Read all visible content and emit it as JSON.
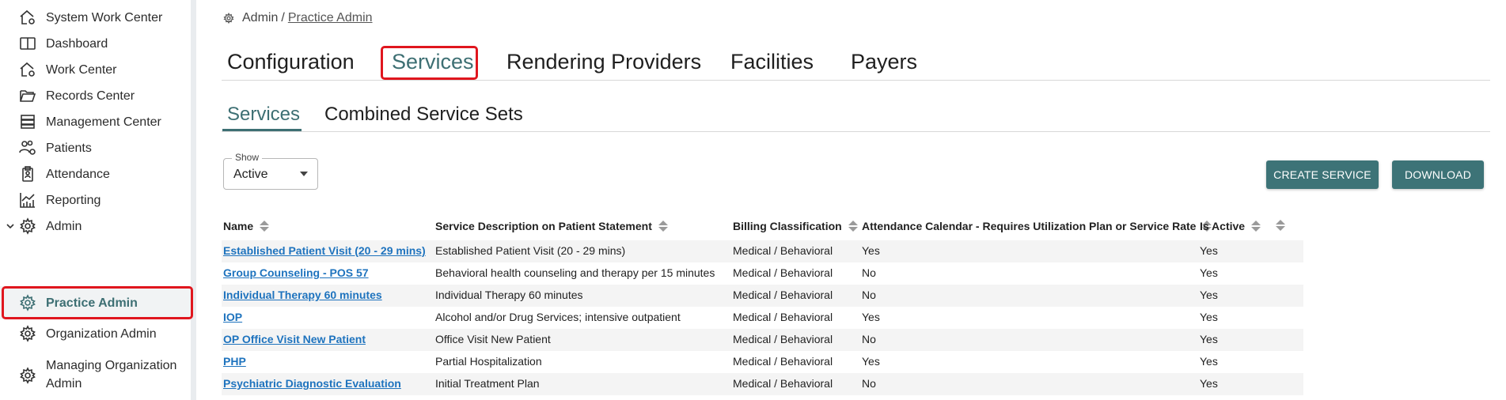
{
  "sidebar": {
    "items": [
      {
        "label": "System Work Center",
        "icon": "home-gear-icon"
      },
      {
        "label": "Dashboard",
        "icon": "book-icon"
      },
      {
        "label": "Work Center",
        "icon": "home-gear-icon"
      },
      {
        "label": "Records Center",
        "icon": "folder-open-icon"
      },
      {
        "label": "Management Center",
        "icon": "server-icon"
      },
      {
        "label": "Patients",
        "icon": "users-gear-icon"
      },
      {
        "label": "Attendance",
        "icon": "clipboard-icon"
      },
      {
        "label": "Reporting",
        "icon": "chart-icon"
      },
      {
        "label": "Admin",
        "icon": "gear-icon"
      },
      {
        "label": "Practice Admin",
        "icon": "gear-icon"
      },
      {
        "label": "Organization Admin",
        "icon": "gear-icon"
      },
      {
        "label": "Managing Organization",
        "label2": "Admin",
        "icon": "gear-icon"
      }
    ]
  },
  "breadcrumb": {
    "root": "Admin",
    "separator": "/",
    "current": "Practice Admin"
  },
  "tabs": [
    {
      "label": "Configuration"
    },
    {
      "label": "Services"
    },
    {
      "label": "Rendering Providers"
    },
    {
      "label": "Facilities"
    },
    {
      "label": "Payers"
    }
  ],
  "subtabs": [
    {
      "label": "Services"
    },
    {
      "label": "Combined Service Sets"
    }
  ],
  "filter": {
    "legend": "Show",
    "value": "Active"
  },
  "buttons": {
    "create": "CREATE SERVICE",
    "download": "DOWNLOAD"
  },
  "table": {
    "headers": [
      "Name",
      "Service Description on Patient Statement",
      "Billing Classification",
      "Attendance Calendar - Requires Utilization Plan or Service Rate",
      "Is Active"
    ],
    "rows": [
      [
        "Established Patient Visit (20 - 29 mins)",
        "Established Patient Visit (20 - 29 mins)",
        "Medical / Behavioral",
        "Yes",
        "Yes"
      ],
      [
        "Group Counseling - POS 57",
        "Behavioral health counseling and therapy per 15 minutes",
        "Medical / Behavioral",
        "No",
        "Yes"
      ],
      [
        "Individual Therapy 60 minutes",
        "Individual Therapy 60 minutes",
        "Medical / Behavioral",
        "No",
        "Yes"
      ],
      [
        "IOP",
        "Alcohol and/or Drug Services; intensive outpatient",
        "Medical / Behavioral",
        "Yes",
        "Yes"
      ],
      [
        "OP Office Visit New Patient",
        "Office Visit New Patient",
        "Medical / Behavioral",
        "No",
        "Yes"
      ],
      [
        "PHP",
        "Partial Hospitalization",
        "Medical / Behavioral",
        "Yes",
        "Yes"
      ],
      [
        "Psychiatric Diagnostic Evaluation",
        "Initial Treatment Plan",
        "Medical / Behavioral",
        "No",
        "Yes"
      ]
    ]
  },
  "colors": {
    "accent": "#3d6f73",
    "highlight": "#e0161e",
    "link": "#1e73be"
  }
}
